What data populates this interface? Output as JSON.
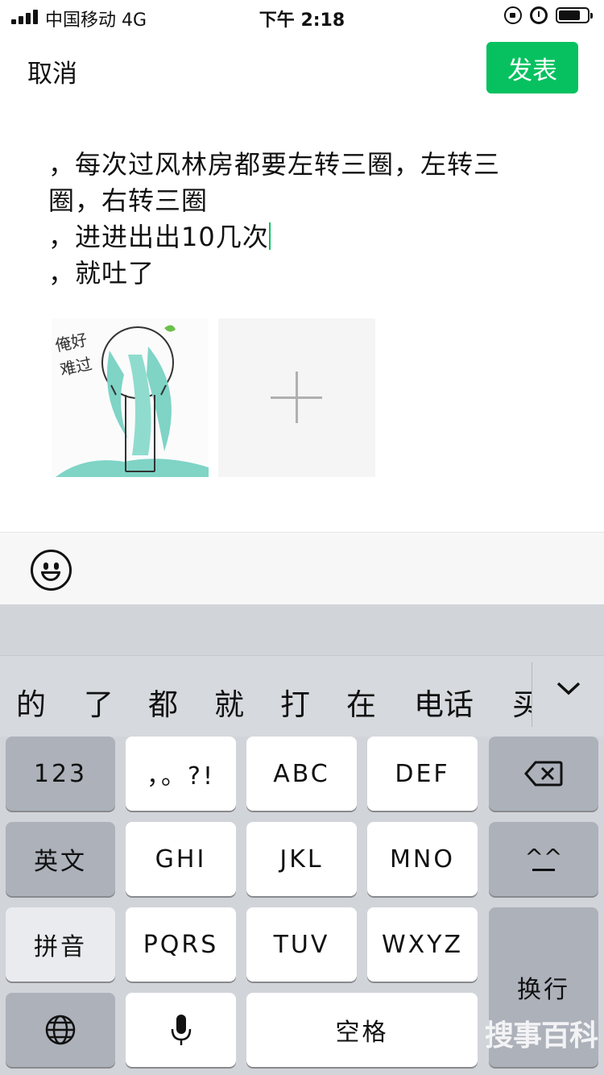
{
  "status_bar": {
    "carrier": "中国移动  4G",
    "time": "下午 2:18"
  },
  "nav": {
    "cancel": "取消",
    "publish": "发表"
  },
  "post": {
    "lines": [
      "，每次过风林房都要左转三圈，左转三",
      "圈，右转三圈",
      "，进进出出10几次",
      "，就吐了"
    ]
  },
  "image": {
    "caption_line1": "俺好",
    "caption_line2": "难过"
  },
  "candidates": [
    "的",
    "了",
    "都",
    "就",
    "打",
    "在",
    "电话",
    "买"
  ],
  "keys": {
    "num": "123",
    "punct": "，。?!",
    "abc": "ABC",
    "def": "DEF",
    "english": "英文",
    "ghi": "GHI",
    "jkl": "JKL",
    "mno": "MNO",
    "face": "^^",
    "pinyin": "拼音",
    "pqrs": "PQRS",
    "tuv": "TUV",
    "wxyz": "WXYZ",
    "newline": "换行",
    "space": "空格"
  },
  "watermark": "搜事百科",
  "colors": {
    "accent": "#07c160",
    "keyboard_bg": "#d1d4d9",
    "key_dark": "#acb1ba"
  }
}
